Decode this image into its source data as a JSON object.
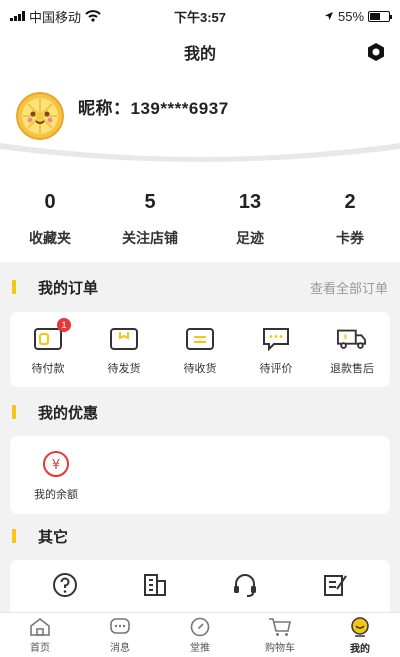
{
  "status_bar": {
    "carrier": "中国移动",
    "time": "下午3:57",
    "battery": "55%",
    "battery_level": 0.55
  },
  "nav": {
    "title": "我的",
    "settings_icon": "hexagon-settings-icon"
  },
  "profile": {
    "nickname": "昵称：139****6937",
    "avatar_icon": "lemon-avatar-icon"
  },
  "stats": [
    {
      "value": "0",
      "label": "收藏夹"
    },
    {
      "value": "5",
      "label": "关注店铺"
    },
    {
      "value": "13",
      "label": "足迹"
    },
    {
      "value": "2",
      "label": "卡券"
    }
  ],
  "orders": {
    "title": "我的订单",
    "more": "查看全部订单",
    "items": [
      {
        "label": "待付款",
        "icon": "wallet-icon",
        "badge": "1"
      },
      {
        "label": "待发货",
        "icon": "package-icon"
      },
      {
        "label": "待收货",
        "icon": "receive-icon"
      },
      {
        "label": "待评价",
        "icon": "comment-icon"
      },
      {
        "label": "退款售后",
        "icon": "truck-icon"
      }
    ]
  },
  "discounts": {
    "title": "我的优惠",
    "balance_label": "我的余额",
    "balance_icon": "yen-icon"
  },
  "others": {
    "title": "其它",
    "items": [
      {
        "icon": "help-icon"
      },
      {
        "icon": "building-icon"
      },
      {
        "icon": "headset-icon"
      },
      {
        "icon": "edit-icon"
      }
    ]
  },
  "tabbar": [
    {
      "label": "首页",
      "icon": "home-icon"
    },
    {
      "label": "消息",
      "icon": "message-icon"
    },
    {
      "label": "堂推",
      "icon": "compass-icon"
    },
    {
      "label": "购物车",
      "icon": "cart-icon"
    },
    {
      "label": "我的",
      "icon": "profile-icon",
      "active": true
    }
  ],
  "colors": {
    "accent": "#f5c518",
    "badge": "#e53935",
    "yen": "#e53935"
  }
}
